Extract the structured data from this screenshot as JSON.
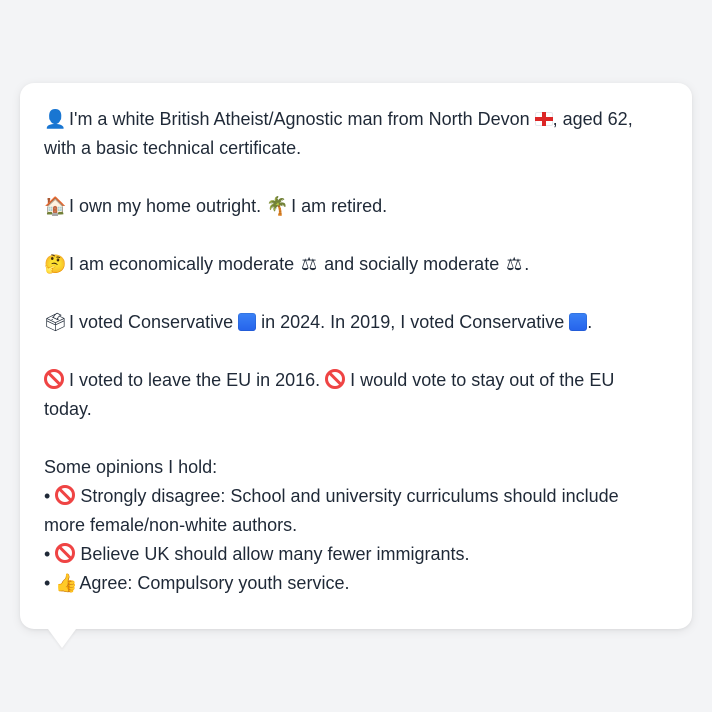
{
  "profile": {
    "intro": {
      "icon": "person-silhouette-icon",
      "glyph": "👤",
      "text_a": " I'm a white British Atheist/Agnostic man from North Devon ",
      "flag_icon": "england-flag-icon",
      "text_b": ", aged 62,",
      "text_c": "with a basic technical certificate."
    },
    "home": {
      "house_glyph": "🏠",
      "text_a": " I own my home outright. ",
      "palm_glyph": "🌴",
      "text_b": " I am retired."
    },
    "politics": {
      "thinking_glyph": "🤔",
      "text_a": " I am economically moderate ",
      "scales_glyph": "⚖",
      "text_b": " and socially moderate ",
      "text_c": "."
    },
    "votes": {
      "ballot_glyph": "🗳",
      "text_a": " I voted Conservative ",
      "text_b": " in 2024. In 2019, I voted Conservative ",
      "text_c": ".",
      "party_color": "#2563eb"
    },
    "eu": {
      "text_a": " I voted to leave the EU in 2016. ",
      "text_b": " I would vote to stay out of the EU",
      "text_c": "today."
    },
    "opinions": {
      "heading": "Some opinions I hold:",
      "items": [
        {
          "bullet": "•",
          "icon": "prohibited-icon",
          "text_a": " Strongly disagree: School and university curriculums should include",
          "text_b": "more female/non-white authors."
        },
        {
          "bullet": "•",
          "icon": "prohibited-icon",
          "text_a": " Believe UK should allow many fewer immigrants."
        },
        {
          "bullet": "•",
          "icon": "thumbs-up-icon",
          "glyph": "👍",
          "text_a": " Agree: Compulsory youth service."
        }
      ]
    }
  }
}
